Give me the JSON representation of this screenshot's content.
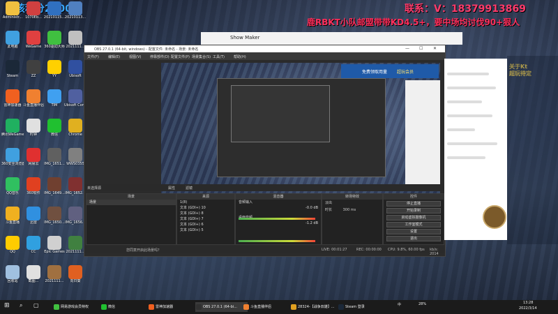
{
  "overlay": {
    "left_text": "该积分2400！",
    "right_text": "联系：V：18379913869",
    "mid_text": "鹿RBKT小队邮盟带带KD4.5+，要中场均讨伐90+狠人",
    "tr_line1": "关于Kt",
    "tr_line2": "超玩待定"
  },
  "desktop_icons": [
    {
      "label": "Administr...",
      "color": "#f0c040"
    },
    {
      "label": "1070Eb...",
      "color": "#d04040"
    },
    {
      "label": "20210115...",
      "color": "#3070c0"
    },
    {
      "label": "20210113...",
      "color": "#5080c0"
    },
    {
      "label": "此电脑",
      "color": "#40a0e0"
    },
    {
      "label": "WeGame",
      "color": "#e04040"
    },
    {
      "label": "360驱动大师",
      "color": "#40c040"
    },
    {
      "label": "2021111...",
      "color": "#c0c0c0"
    },
    {
      "label": "Steam",
      "color": "#1b2838"
    },
    {
      "label": "ZZ",
      "color": "#404040"
    },
    {
      "label": "YY",
      "color": "#ffd000"
    },
    {
      "label": "Ubisoft",
      "color": "#3050a0"
    },
    {
      "label": "雷神加速器",
      "color": "#f06020"
    },
    {
      "label": "斗鱼直播伴侣",
      "color": "#f08030"
    },
    {
      "label": "TIM",
      "color": "#40a0f0"
    },
    {
      "label": "Ubisoft Con...",
      "color": "#5060a0"
    },
    {
      "label": "腾讯WeGame",
      "color": "#20b060"
    },
    {
      "label": "时钟",
      "color": "#e0e0e0"
    },
    {
      "label": "微信",
      "color": "#20c030"
    },
    {
      "label": "Chrome",
      "color": "#e0b020"
    },
    {
      "label": "360安全浏览器",
      "color": "#40a0e0"
    },
    {
      "label": "网易云",
      "color": "#e03030"
    },
    {
      "label": "IMG_1651...",
      "color": "#606060"
    },
    {
      "label": "WWS0355",
      "color": "#808080"
    },
    {
      "label": "QQ音乐",
      "color": "#30c060"
    },
    {
      "label": "360软件",
      "color": "#e04020"
    },
    {
      "label": "IMG_1649...",
      "color": "#704030"
    },
    {
      "label": "IMG_1652...",
      "color": "#803030"
    },
    {
      "label": "斗鱼直播",
      "color": "#f0b020"
    },
    {
      "label": "迅雷",
      "color": "#3090e0"
    },
    {
      "label": "IMG_1650...",
      "color": "#705040"
    },
    {
      "label": "IMG_1656...",
      "color": "#606080"
    },
    {
      "label": "QQ",
      "color": "#ffcc00"
    },
    {
      "label": "CC",
      "color": "#30a0e0"
    },
    {
      "label": "Epic Games",
      "color": "#d0d0d0"
    },
    {
      "label": "2021111...",
      "color": "#408040"
    },
    {
      "label": "回收站",
      "color": "#a0c0e0"
    },
    {
      "label": "截图...",
      "color": "#e0e0e0"
    },
    {
      "label": "2021111...",
      "color": "#a07040"
    },
    {
      "label": "向日葵",
      "color": "#e06020"
    }
  ],
  "showmaker": {
    "title": "Show Maker"
  },
  "obs": {
    "title": "OBS 27.0.1 (64-bit, windows) - 配置文件: 未命名 - 场景: 未命名",
    "menu": [
      "文件(F)",
      "编辑(E)",
      "视图(V)",
      "停靠部件(D)",
      "配置文件(P)",
      "场景集合(S)",
      "工具(T)",
      "帮助(H)"
    ],
    "banner": "免费领取用量",
    "banner2": "超玩会员",
    "src_label": "未选择源",
    "src_props": "属性",
    "src_filters": "滤镜",
    "scenes_header": "场景",
    "scenes": [
      "场景"
    ],
    "sources_header": "来源",
    "sources": [
      "文本 (GDI+) 10",
      "文本 (GDI+) 8",
      "文本 (GDI+) 7",
      "文本 (GDI+) 6",
      "文本 (GDI+) 5"
    ],
    "source_first": "1(8)",
    "mixer_header": "混音器",
    "mixer": [
      {
        "name": "音频输入",
        "db": "-0.0 dB"
      },
      {
        "name": "桌面音频",
        "db": "-1.2 dB"
      }
    ],
    "transition_header": "转场特效",
    "transition_type": "淡出",
    "transition_dur_label": "时长",
    "transition_dur": "300 ms",
    "controls_header": "控件",
    "controls": [
      "停止直播",
      "开始录制",
      "虚拟摄像机",
      "启动虚拟摄像机",
      "工作室模式",
      "设置",
      "退出"
    ],
    "status": {
      "live": "LIVE: 00:01:27",
      "rec": "REC: 00:00:00",
      "cpu": "CPU: 9.8%, 60.00 fps",
      "kb": "kb/s: 2014"
    },
    "notice": "您同意开启此场景吗？"
  },
  "taskbar": {
    "items": [
      {
        "label": "网易游戏会员特权",
        "color": "#40c040"
      },
      {
        "label": "微信",
        "color": "#20c030"
      },
      {
        "label": "雷神加速器",
        "color": "#f06020"
      },
      {
        "label": "OBS 27.0.1 (64-bi...",
        "color": "#303030"
      },
      {
        "label": "斗鱼直播伴侣",
        "color": "#f08030"
      },
      {
        "label": "28324-【战争双雄】...",
        "color": "#e0a020"
      },
      {
        "label": "Steam 登录",
        "color": "#1b2838"
      }
    ],
    "ime": "中",
    "temp": "28%",
    "time": "13:28",
    "date": "2022/3/14"
  }
}
